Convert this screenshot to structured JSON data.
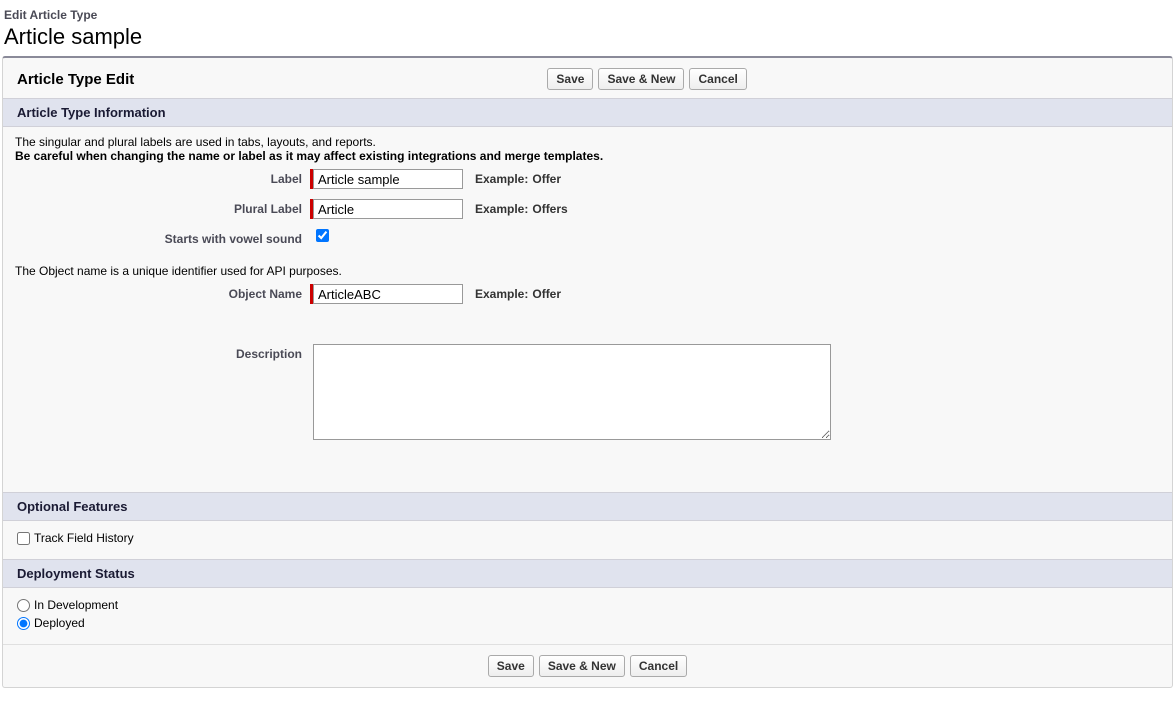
{
  "breadcrumb": "Edit Article Type",
  "page_title": "Article sample",
  "panel_title": "Article Type Edit",
  "buttons": {
    "save": "Save",
    "save_new": "Save & New",
    "cancel": "Cancel"
  },
  "section": {
    "info_title": "Article Type Information",
    "help1": "The singular and plural labels are used in tabs, layouts, and reports.",
    "help2": "Be careful when changing the name or label as it may affect existing integrations and merge templates.",
    "label": {
      "text": "Label",
      "value": "Article sample",
      "example_label": "Example:",
      "example_val": "Offer"
    },
    "plural": {
      "text": "Plural Label",
      "value": "Article",
      "example_label": "Example:",
      "example_val": "Offers"
    },
    "vowel": {
      "text": "Starts with vowel sound",
      "checked": true
    },
    "object_help": "The Object name is a unique identifier used for API purposes.",
    "object": {
      "text": "Object Name",
      "value": "ArticleABC",
      "example_label": "Example:",
      "example_val": "Offer"
    },
    "description": {
      "text": "Description",
      "value": ""
    }
  },
  "optional": {
    "title": "Optional Features",
    "track": {
      "text": "Track Field History",
      "checked": false
    }
  },
  "deploy": {
    "title": "Deployment Status",
    "in_dev": "In Development",
    "deployed": "Deployed",
    "selected": "deployed"
  }
}
